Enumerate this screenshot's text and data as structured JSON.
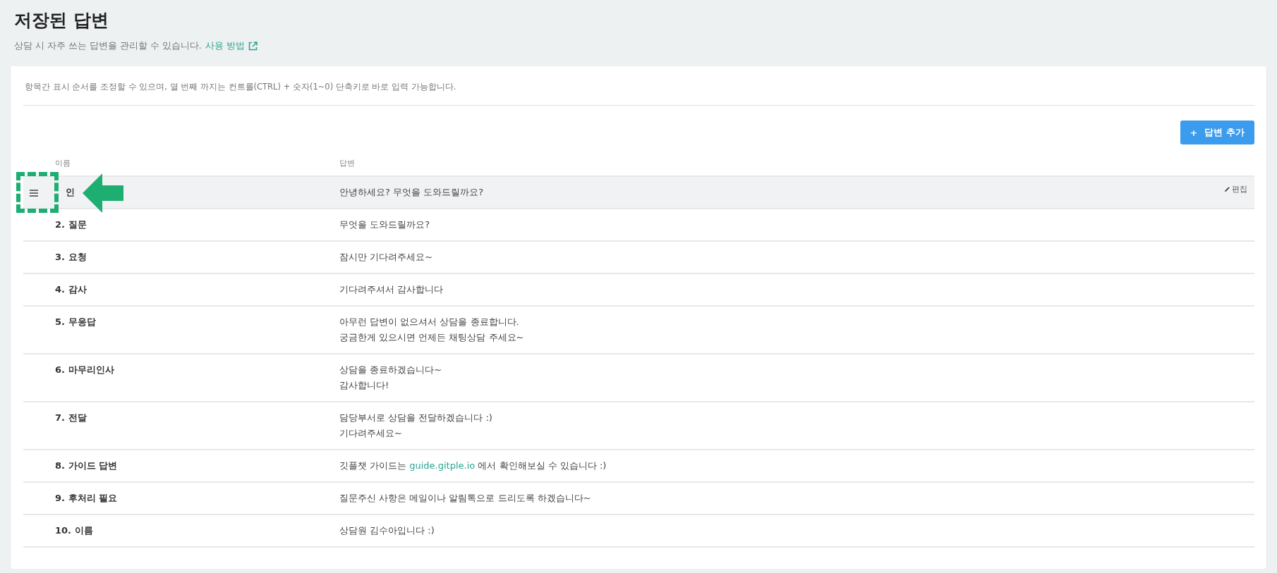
{
  "page": {
    "title": "저장된 답변",
    "subtitle": "상담 시 자주 쓰는 답변을 관리할 수 있습니다.",
    "help_link": "사용 방법"
  },
  "notice": "항목간 표시 순서를 조정할 수 있으며, 열 번째 까지는 컨트롤(CTRL) + 숫자(1~0) 단축키로 바로 입력 가능합니다.",
  "add_button": {
    "icon": "+",
    "label": "답변 추가"
  },
  "table": {
    "columns": [
      "이름",
      "답변"
    ],
    "rows": [
      {
        "name": "인",
        "answer": [
          "안녕하세요? 무엇을 도와드릴까요?"
        ],
        "hovered": true,
        "edit": "편집"
      },
      {
        "name": "2. 질문",
        "answer": [
          "무엇을 도와드릴까요?"
        ],
        "hovered": false
      },
      {
        "name": "3. 요청",
        "answer": [
          "잠시만 기다려주세요~"
        ],
        "hovered": false
      },
      {
        "name": "4. 감사",
        "answer": [
          "기다려주셔서 감사합니다"
        ],
        "hovered": false
      },
      {
        "name": "5. 무응답",
        "answer": [
          "아무런 답변이 없으셔서 상담을 종료합니다.",
          "궁금한게 있으시면 언제든 채팅상담 주세요~"
        ],
        "hovered": false
      },
      {
        "name": "6. 마무리인사",
        "answer": [
          "상담을 종료하겠습니다~",
          "감사합니다!"
        ],
        "hovered": false
      },
      {
        "name": "7. 전달",
        "answer": [
          "담당부서로 상담을 전달하겠습니다 :)",
          "기다려주세요~"
        ],
        "hovered": false
      },
      {
        "name": "8. 가이드 답변",
        "answer": [
          [
            {
              "text": "깃플챗 가이드는 "
            },
            {
              "text": "guide.gitple.io",
              "kind": "link"
            },
            {
              "text": " 에서 확인해보실 수 있습니다 :)"
            }
          ]
        ],
        "hovered": false
      },
      {
        "name": "9. 후처리 필요",
        "answer": [
          "질문주신 사항은 메일이나 알림톡으로 드리도록 하겠습니다~"
        ],
        "hovered": false
      },
      {
        "name": "10. 이름",
        "answer": [
          "상담원 김수아입니다 :)"
        ],
        "hovered": false
      }
    ]
  }
}
